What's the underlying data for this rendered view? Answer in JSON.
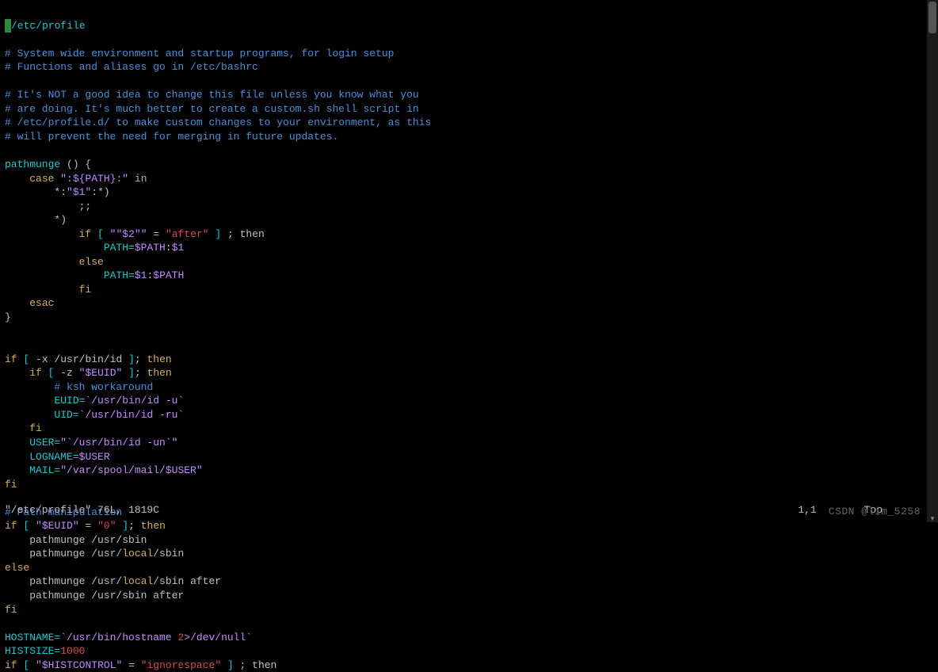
{
  "file_path": "/etc/profile",
  "comments": {
    "c1": "# System wide environment and startup programs, for login setup",
    "c2": "# Functions and aliases go in /etc/bashrc",
    "c3": "# It's NOT a good idea to change this file unless you know what you",
    "c4": "# are doing. It's much better to create a custom.sh shell script in",
    "c5": "# /etc/profile.d/ to make custom changes to your environment, as this",
    "c6": "# will prevent the need for merging in future updates.",
    "c7": "# ksh workaround",
    "c8": "# Path manipulation"
  },
  "tokens": {
    "pathmunge": "pathmunge",
    "case": "case",
    "in": "in",
    "esac": "esac",
    "if": "if",
    "then": "then",
    "else": "else",
    "fi": "fi",
    "lbrace": "() {",
    "rbrace": "}",
    "pathexpr": "\":${PATH}:\"",
    "star1": "*:\"$1\":*)",
    "semisemi": ";;",
    "star": "*)",
    "lbracket": "[",
    "rbracket": "]",
    "dollar2": "\"$2\"",
    "eq": "=",
    "after": "\"after\"",
    "semi_then": " ; then",
    "path_assign": "PATH=",
    "path_v": "$PATH",
    "colon": ":",
    "d1": "$1",
    "usr_bin_id": " -x /usr/bin/id ",
    "z_euid": " -z ",
    "euid_q": "\"$EUID\"",
    "euid_assign": "EUID=",
    "uid_assign": "UID=",
    "id_u": "`/usr/bin/id -u`",
    "id_ru": "`/usr/bin/id -ru`",
    "user_assign": "USER=",
    "id_un": "\"`/usr/bin/id -un`\"",
    "logname_assign": "LOGNAME=",
    "user_var": "$USER",
    "mail_assign": "MAIL=",
    "mail_path": "\"/var/spool/mail/$USER\"",
    "zero_str": "\"0\"",
    "pm1": "    pathmunge /usr/sbin",
    "pm2": "    pathmunge /usr/",
    "local": "local",
    "sbin": "/sbin",
    "after_plain": " after",
    "pm3": "    pathmunge /usr/sbin after",
    "hostname_assign": "HOSTNAME=",
    "hostname_cmd": "`/usr/bin/hostname ",
    "two": "2",
    "devnull": ">/dev/null`",
    "histsize_assign": "HISTSIZE=",
    "thousand": "1000",
    "histcontrol": "\"$HISTCONTROL\"",
    "ignorespace": "\"ignorespace\""
  },
  "status": {
    "left": "\"/etc/profile\" 76L, 1819C",
    "rowcol": "1,1",
    "pos": "Top"
  },
  "watermark": "CSDN @lim_5258"
}
